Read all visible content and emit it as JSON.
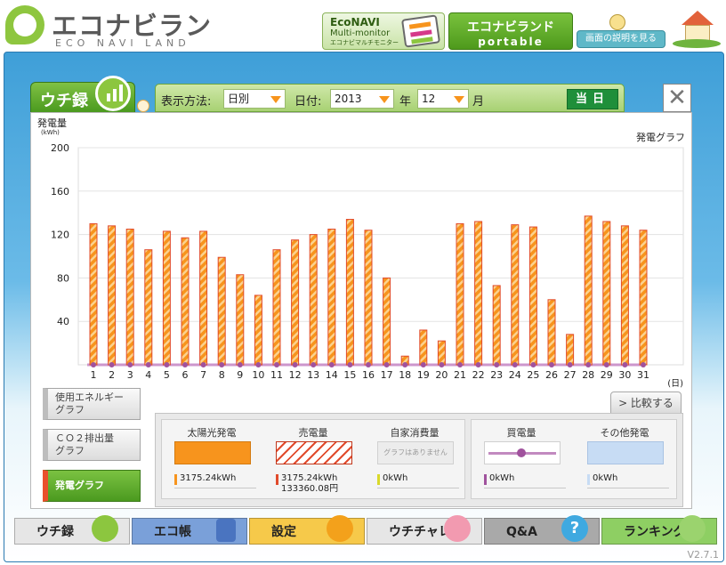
{
  "header": {
    "logo_title": "エコナビランド",
    "logo_sub": "ECO NAVI LAND",
    "econavi": {
      "line1": "EcoNAVI",
      "line2": "Multi-monitor",
      "line3": "エコナビマルチモニター"
    },
    "portable": {
      "line1": "エコナビランド",
      "line2": "portable"
    },
    "help_label": "画面の説明を見る"
  },
  "tab": {
    "label": "ウチ録"
  },
  "toolbar": {
    "display_label": "表示方法:",
    "display_value": "日別",
    "date_label": "日付:",
    "year_value": "2013",
    "year_unit": "年",
    "month_value": "12",
    "month_unit": "月",
    "today_label": "当日"
  },
  "close_label": "✕",
  "chart_data": {
    "type": "bar",
    "title": "発電グラフ",
    "ylabel": "発電量",
    "yunit": "(kWh)",
    "xunit": "(日)",
    "ylim": [
      0,
      200
    ],
    "yticks": [
      40,
      80,
      120,
      160,
      200
    ],
    "categories": [
      "1",
      "2",
      "3",
      "4",
      "5",
      "6",
      "7",
      "8",
      "9",
      "10",
      "11",
      "12",
      "13",
      "14",
      "15",
      "16",
      "17",
      "18",
      "19",
      "20",
      "21",
      "22",
      "23",
      "24",
      "25",
      "26",
      "27",
      "28",
      "29",
      "30",
      "31"
    ],
    "values": [
      130,
      128,
      125,
      106,
      123,
      117,
      123,
      99,
      83,
      64,
      106,
      115,
      120,
      125,
      134,
      124,
      80,
      8,
      32,
      22,
      130,
      132,
      73,
      129,
      127,
      60,
      28,
      137,
      132,
      128,
      124
    ],
    "bar_color": "#f7941d",
    "hatch_color": "#e14b2c"
  },
  "side_buttons": [
    {
      "label": "使用エネルギー\nグラフ",
      "line1": "使用エネルギー",
      "line2": "グラフ"
    },
    {
      "line1": "ＣＯ２排出量",
      "line2": "グラフ"
    },
    {
      "line1": "発電グラフ",
      "line2": ""
    }
  ],
  "compare_label": "> 比較する",
  "summary": {
    "solar": {
      "title": "太陽光発電",
      "value": "3175.24kWh"
    },
    "sold": {
      "title": "売電量",
      "value": "3175.24kWh",
      "value2": "133360.08円"
    },
    "self": {
      "title": "自家消費量",
      "swatch_text": "グラフはありません",
      "value": "0kWh"
    },
    "bought": {
      "title": "買電量",
      "value": "0kWh"
    },
    "other": {
      "title": "その他発電",
      "value": "0kWh"
    }
  },
  "nav": [
    {
      "label": "ウチ録",
      "color": "#e8e8e8"
    },
    {
      "label": "エコ帳",
      "color": "#7aa0d9"
    },
    {
      "label": "設定",
      "color": "#f6c94a"
    },
    {
      "label": "ウチチャレ",
      "color": "#e6e6e6"
    },
    {
      "label": "Q&A",
      "color": "#a9a9a9"
    },
    {
      "label": "ランキング",
      "color": "#8ecf63"
    }
  ],
  "version": "V2.7.1"
}
